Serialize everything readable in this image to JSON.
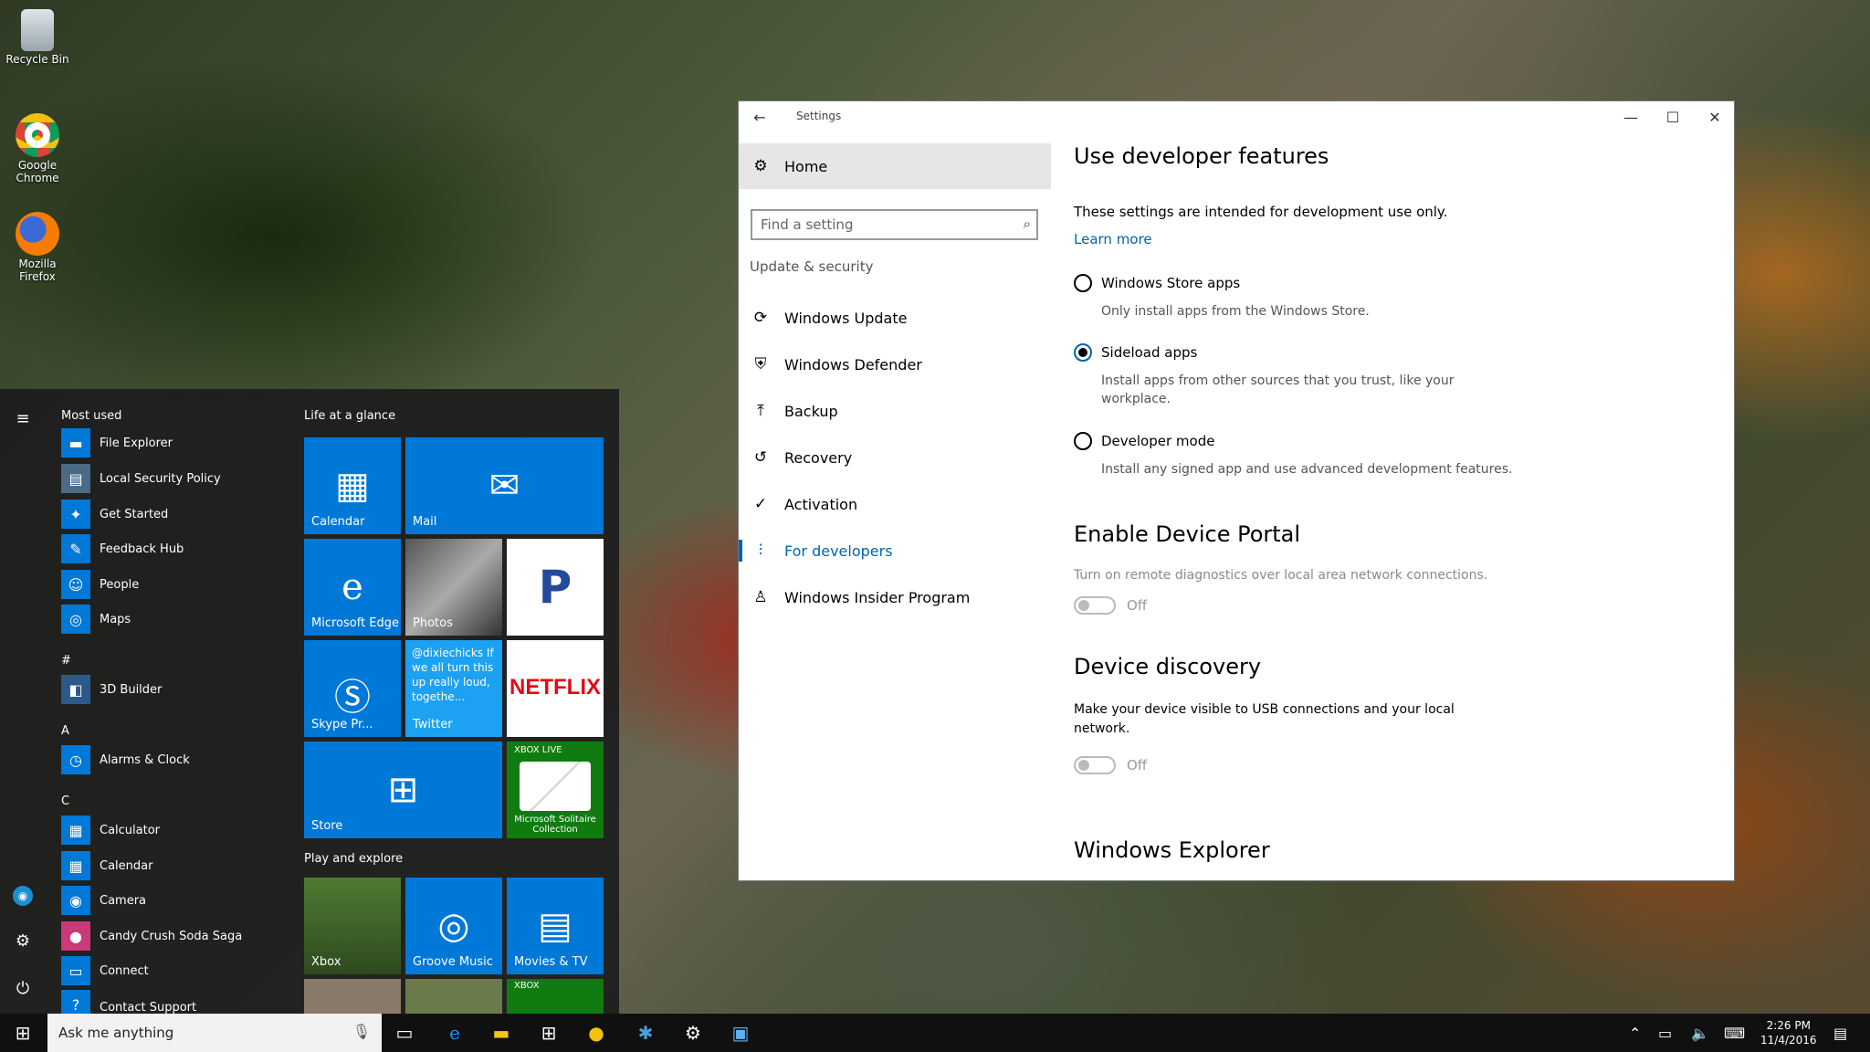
{
  "desktop": {
    "icons": [
      {
        "label": "Recycle Bin"
      },
      {
        "label": "Google Chrome"
      },
      {
        "label": "Mozilla Firefox"
      }
    ]
  },
  "start": {
    "most_used_heading": "Most used",
    "most_used": [
      {
        "label": "File Explorer",
        "icon": "folder-icon"
      },
      {
        "label": "Local Security Policy",
        "icon": "policy-icon"
      },
      {
        "label": "Get Started",
        "icon": "lightbulb-icon"
      },
      {
        "label": "Feedback Hub",
        "icon": "feedback-icon"
      },
      {
        "label": "People",
        "icon": "people-icon"
      },
      {
        "label": "Maps",
        "icon": "maps-icon"
      }
    ],
    "groups": [
      {
        "letter": "#",
        "items": [
          {
            "label": "3D Builder"
          }
        ]
      },
      {
        "letter": "A",
        "items": [
          {
            "label": "Alarms & Clock"
          }
        ]
      },
      {
        "letter": "C",
        "items": [
          {
            "label": "Calculator"
          },
          {
            "label": "Calendar"
          },
          {
            "label": "Camera"
          },
          {
            "label": "Candy Crush Soda Saga"
          },
          {
            "label": "Connect"
          },
          {
            "label": "Contact Support"
          }
        ]
      }
    ],
    "life_heading": "Life at a glance",
    "play_heading": "Play and explore",
    "tiles": {
      "calendar": "Calendar",
      "mail": "Mail",
      "edge": "Microsoft Edge",
      "photos": "Photos",
      "pandora": "P",
      "skype": "Skype Pr...",
      "twitter_text": "@dixiechicks If we all turn this up really loud, togethe...",
      "twitter": "Twitter",
      "netflix": "NETFLIX",
      "store": "Store",
      "xbox_live": "XBOX LIVE",
      "solitaire": "Microsoft Solitaire Collection",
      "xbox": "Xbox",
      "groove": "Groove Music",
      "movies": "Movies & TV",
      "xbox_small": "XBOX"
    }
  },
  "taskbar": {
    "search_placeholder": "Ask me anything",
    "time": "2:26 PM",
    "date": "11/4/2016"
  },
  "settings": {
    "title": "Settings",
    "home": "Home",
    "find_placeholder": "Find a setting",
    "section": "Update & security",
    "nav": [
      {
        "label": "Windows Update",
        "icon": "sync-icon"
      },
      {
        "label": "Windows Defender",
        "icon": "shield-icon"
      },
      {
        "label": "Backup",
        "icon": "upload-icon"
      },
      {
        "label": "Recovery",
        "icon": "history-icon"
      },
      {
        "label": "Activation",
        "icon": "check-circle-icon"
      },
      {
        "label": "For developers",
        "icon": "developer-icon",
        "active": true
      },
      {
        "label": "Windows Insider Program",
        "icon": "person-icon"
      }
    ],
    "content": {
      "heading": "Use developer features",
      "intro": "These settings are intended for development use only.",
      "learn_more": "Learn more",
      "options": [
        {
          "label": "Windows Store apps",
          "desc": "Only install apps from the Windows Store.",
          "selected": false
        },
        {
          "label": "Sideload apps",
          "desc": "Install apps from other sources that you trust, like your workplace.",
          "selected": true
        },
        {
          "label": "Developer mode",
          "desc": "Install any signed app and use advanced development features.",
          "selected": false
        }
      ],
      "portal_heading": "Enable Device Portal",
      "portal_desc": "Turn on remote diagnostics over local area network connections.",
      "portal_toggle": "Off",
      "discovery_heading": "Device discovery",
      "discovery_desc": "Make your device visible to USB connections and your local network.",
      "discovery_toggle": "Off",
      "explorer_heading": "Windows Explorer"
    }
  },
  "colors": {
    "accent": "#0078d7",
    "link": "#0063b1"
  }
}
